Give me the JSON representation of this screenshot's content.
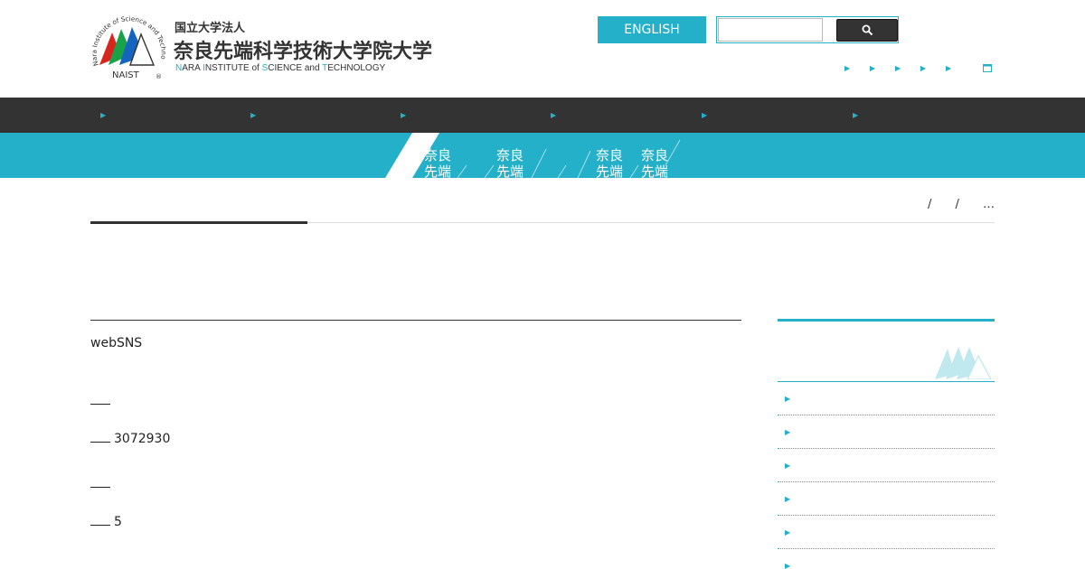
{
  "header": {
    "logo_emblem_text": "Nara Institute of Science and Technology",
    "logo_emblem_short": "NAIST",
    "logo_small": "国立大学法人",
    "logo_big": "奈良先端科学技術大学院大学",
    "logo_en": {
      "p1_hl": "N",
      "p1": "ARA ",
      "p2_hl": "I",
      "p2": "NSTITUTE of ",
      "p3_hl": "S",
      "p3": "CIENCE and ",
      "p4_hl": "T",
      "p4": "ECHNOLOGY"
    },
    "english_label": "ENGLISH",
    "search_placeholder": "",
    "search_icon": "search-icon",
    "util_icon": "triangle-right-icon",
    "window_icon": "new-window-icon"
  },
  "navbar": {
    "item_icon": "triangle-right-icon",
    "items": [
      "",
      "",
      "",
      "",
      "",
      ""
    ]
  },
  "band": {
    "labels": [
      [
        "奈良",
        "先端"
      ],
      [
        "奈良",
        "先端"
      ],
      [
        "奈良",
        "先端"
      ],
      [
        "奈良",
        "先端"
      ]
    ]
  },
  "breadcrumb": {
    "sep1": "/",
    "sep2": "/",
    "last": "…"
  },
  "main": {
    "lines": [
      {
        "prefix": "",
        "text": "webSNS"
      },
      {
        "prefix": "dash",
        "text": ""
      },
      {
        "prefix": "dash",
        "text": "3072930"
      },
      {
        "prefix": "dash",
        "text": ""
      },
      {
        "prefix": "dash",
        "text": "5"
      }
    ]
  },
  "side": {
    "emblem": "naist-mountain-logo",
    "items": [
      "",
      "",
      "",
      "",
      "",
      ""
    ]
  },
  "colors": {
    "accent": "#23b0c8",
    "dark": "#333333"
  }
}
